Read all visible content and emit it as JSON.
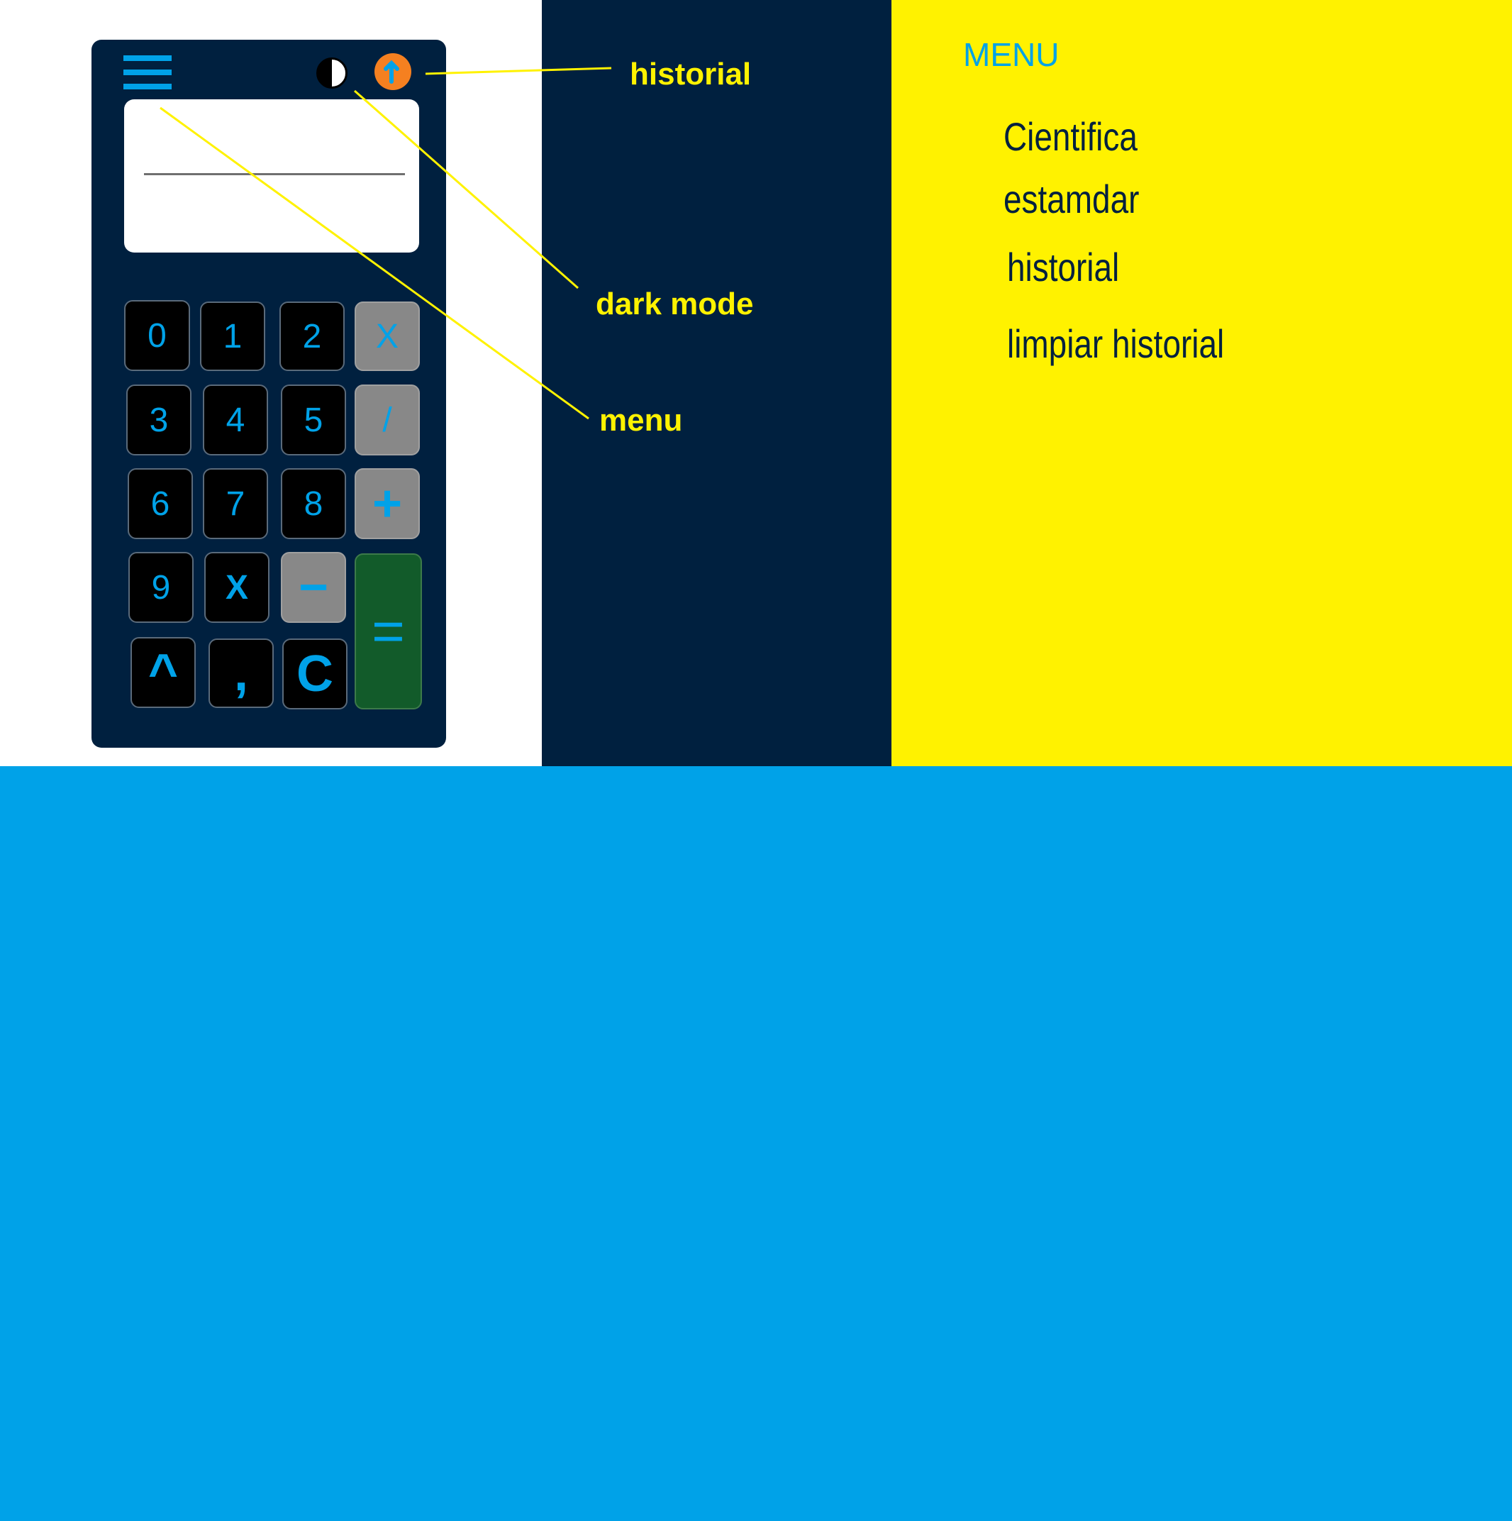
{
  "calculator": {
    "keys": {
      "k0": "0",
      "k1": "1",
      "k2": "2",
      "mul": "X",
      "k3": "3",
      "k4": "4",
      "k5": "5",
      "div": "/",
      "k6": "6",
      "k7": "7",
      "k8": "8",
      "add": "+",
      "k9": "9",
      "x": "X",
      "sub": "−",
      "eq": "=",
      "pow": "^",
      "comma": ",",
      "clear": "C"
    }
  },
  "annotations": {
    "historial": "historial",
    "dark_mode": "dark mode",
    "menu": "menu"
  },
  "menu_panel": {
    "title": "MENU",
    "items": [
      "Cientifica",
      "estamdar",
      "historial",
      "limpiar historial"
    ]
  },
  "colors": {
    "navy": "#00203f",
    "yellow": "#fff200",
    "blue": "#00a2e8",
    "orange": "#f58020",
    "green": "#125b2a",
    "gray": "#888888"
  },
  "icons": [
    "hamburger-menu-icon",
    "contrast-icon",
    "history-icon"
  ]
}
